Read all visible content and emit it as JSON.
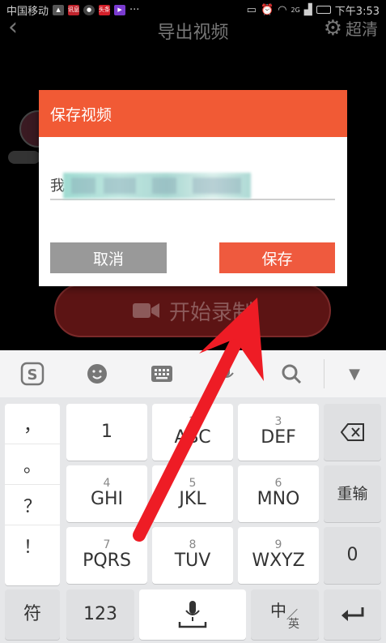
{
  "status_bar": {
    "carrier": "中国移动",
    "icons": [
      "signal-icon",
      "wechat-icon",
      "app-icon",
      "news-icon",
      "video-icon"
    ],
    "app_badges": [
      "讯息",
      "头条"
    ],
    "more": "···",
    "network": "2G",
    "time": "下午3:53"
  },
  "header": {
    "title": "导出视频",
    "settings_label": "超清"
  },
  "record_button": {
    "label": "开始录制"
  },
  "dialog": {
    "title": "保存视频",
    "input_value_visible_prefix": "我",
    "cancel_label": "取消",
    "save_label": "保存"
  },
  "keyboard": {
    "punctuation": [
      "，",
      "。",
      "？",
      "！"
    ],
    "keys": [
      {
        "sub": "",
        "main": "1"
      },
      {
        "sub": "2",
        "main": "ABC"
      },
      {
        "sub": "3",
        "main": "DEF"
      },
      {
        "sub": "4",
        "main": "GHI"
      },
      {
        "sub": "5",
        "main": "JKL"
      },
      {
        "sub": "6",
        "main": "MNO"
      },
      {
        "sub": "7",
        "main": "PQRS"
      },
      {
        "sub": "8",
        "main": "TUV"
      },
      {
        "sub": "9",
        "main": "WXYZ"
      }
    ],
    "reenter_label": "重输",
    "zero_label": "0",
    "symbol_label": "符",
    "numeric_label": "123",
    "lang_main": "中",
    "lang_sub": "英"
  },
  "colors": {
    "accent": "#f15a35",
    "save_button": "#ef5a3e",
    "cancel_button": "#999999",
    "arrow": "#ee1c25"
  }
}
